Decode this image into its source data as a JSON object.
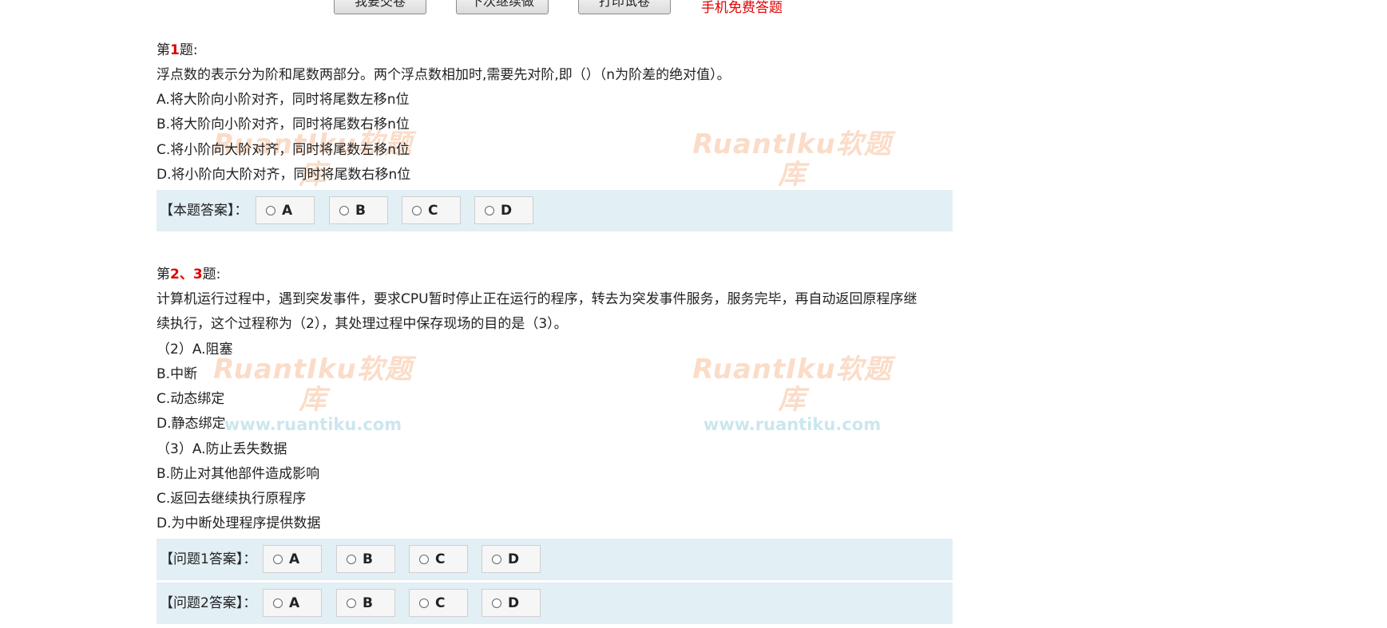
{
  "toolbar": {
    "submit_label": "我要交卷",
    "continue_label": "下次继续做",
    "print_label": "打印试卷",
    "mobile_link": "手机免费答题"
  },
  "watermark": {
    "brand": "RuantIku软题库",
    "url": "www.ruantiku.com"
  },
  "question1": {
    "prefix": "第",
    "number": "1",
    "suffix": "题:",
    "text": "浮点数的表示分为阶和尾数两部分。两个浮点数相加时,需要先对阶,即（）（n为阶差的绝对值）。",
    "options": [
      "A.将大阶向小阶对齐，同时将尾数左移n位",
      "B.将大阶向小阶对齐，同时将尾数右移n位",
      "C.将小阶向大阶对齐，同时将尾数左移n位",
      "D.将小阶向大阶对齐，同时将尾数右移n位"
    ],
    "answer_label": "【本题答案】：",
    "choices": [
      "A",
      "B",
      "C",
      "D"
    ]
  },
  "question2": {
    "prefix": "第",
    "number": "2、3",
    "suffix": "题:",
    "text_line1": "计算机运行过程中，遇到突发事件，要求CPU暂时停止正在运行的程序，转去为突发事件服务，服务完毕，再自动返回原程序继",
    "text_line2": "续执行，这个过程称为（2），其处理过程中保存现场的目的是（3）。",
    "options": [
      "（2）A.阻塞",
      "B.中断",
      "C.动态绑定",
      "D.静态绑定",
      "（3）A.防止丢失数据",
      "B.防止对其他部件造成影响",
      "C.返回去继续执行原程序",
      "D.为中断处理程序提供数据"
    ],
    "answer1_label": "【问题1答案】：",
    "answer2_label": "【问题2答案】：",
    "choices": [
      "A",
      "B",
      "C",
      "D"
    ]
  }
}
